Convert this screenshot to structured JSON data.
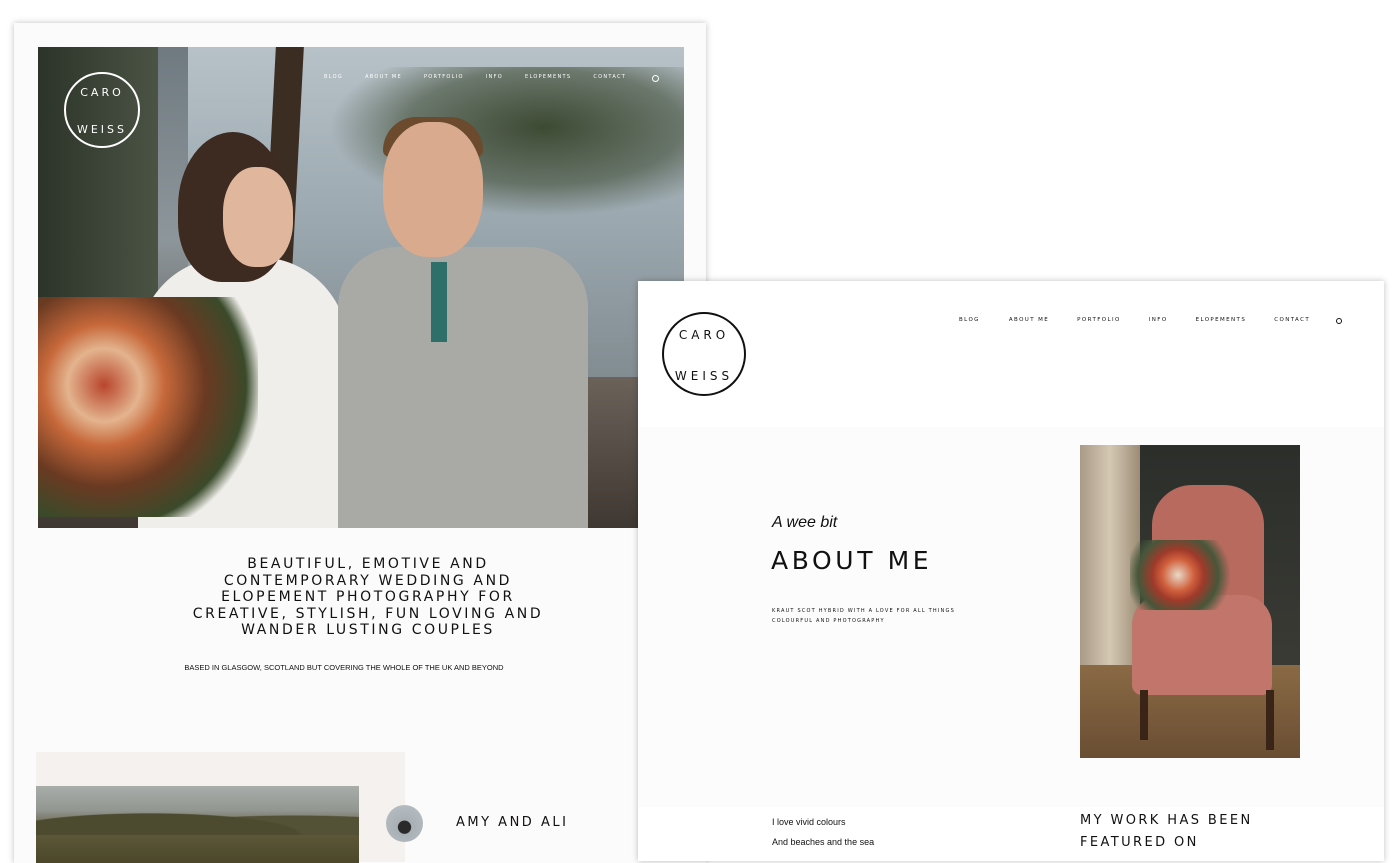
{
  "left_page": {
    "logo": {
      "line1": "CARO",
      "line2": "WEISS"
    },
    "nav": [
      "BLOG",
      "ABOUT ME",
      "PORTFOLIO",
      "INFO",
      "ELOPEMENTS",
      "CONTACT"
    ],
    "search_icon": "search-icon",
    "tagline": "BEAUTIFUL, EMOTIVE AND CONTEMPORARY WEDDING AND ELOPEMENT PHOTOGRAPHY FOR CREATIVE, STYLISH, FUN LOVING AND WANDER LUSTING COUPLES",
    "based": "BASED IN GLASGOW, SCOTLAND BUT COVERING THE WHOLE OF THE UK AND BEYOND",
    "featured_couple": "AMY AND ALI"
  },
  "right_page": {
    "logo": {
      "line1": "CARO",
      "line2": "WEISS"
    },
    "nav": [
      "BLOG",
      "ABOUT ME",
      "PORTFOLIO",
      "INFO",
      "ELOPEMENTS",
      "CONTACT"
    ],
    "search_icon": "search-icon",
    "about_kicker": "A wee bit",
    "about_title": "ABOUT ME",
    "about_subtitle": "KRAUT SCOT HYBRID WITH A LOVE FOR ALL THINGS COLOURFUL AND PHOTOGRAPHY",
    "likes": [
      "I love vivid colours",
      "And beaches and the sea"
    ],
    "featured_heading": "MY WORK HAS BEEN FEATURED ON"
  }
}
